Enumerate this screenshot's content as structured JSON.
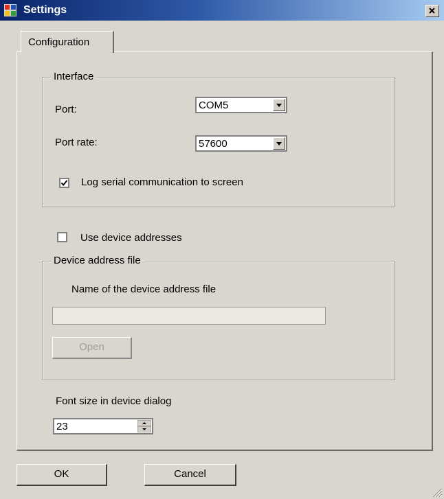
{
  "window": {
    "title": "Settings",
    "close_icon": "close-icon",
    "app_icon": "settings-app-icon"
  },
  "tabs": [
    {
      "label": "Configuration",
      "selected": true
    }
  ],
  "interface": {
    "legend": "Interface",
    "port_label": "Port:",
    "port_value": "COM5",
    "rate_label": "Port rate:",
    "rate_value": "57600",
    "log_label": "Log serial communication to screen",
    "log_checked": true
  },
  "use_addresses": {
    "label": "Use device addresses",
    "checked": false
  },
  "address_file": {
    "legend": "Device address file",
    "name_label": "Name of the device address file",
    "path_value": "",
    "open_label": "Open"
  },
  "font_size": {
    "label": "Font size in device dialog",
    "value": "23"
  },
  "buttons": {
    "ok": "OK",
    "cancel": "Cancel"
  },
  "colors": {
    "face": "#d9d6cf",
    "title_start": "#0a246a",
    "title_end": "#a6caf0"
  }
}
